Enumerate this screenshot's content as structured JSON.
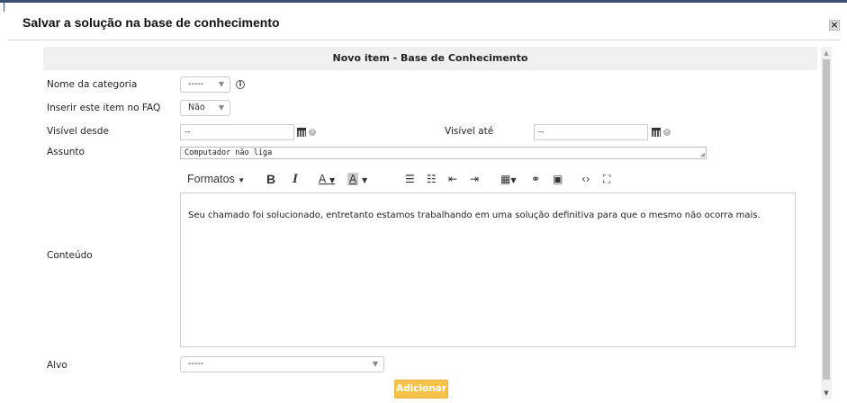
{
  "dialog": {
    "title": "Salvar a solução na base de conhecimento",
    "close_label": "×"
  },
  "form": {
    "section_title": "Novo item - Base de Conhecimento",
    "categoria": {
      "label": "Nome da categoria",
      "value": "-----"
    },
    "faq": {
      "label": "Inserir este item no FAQ",
      "value": "Não"
    },
    "visivel_desde": {
      "label": "Visível desde",
      "value": "--"
    },
    "visivel_ate": {
      "label": "Visível até",
      "value": "--"
    },
    "assunto": {
      "label": "Assunto",
      "value": "Computador não liga"
    },
    "conteudo": {
      "label": "Conteúdo",
      "text": "Seu chamado foi solucionado, entretanto estamos trabalhando em uma solução definitiva para que o mesmo não ocorra mais."
    },
    "alvo": {
      "label": "Alvo",
      "value": "-----"
    },
    "submit_label": "Adicionar"
  },
  "toolbar": {
    "formats_label": "Formatos",
    "bold_label": "B",
    "italic_label": "I",
    "text_color_label": "A",
    "bg_color_label": "A",
    "icons": [
      "caret-down-icon",
      "bullet-list-icon",
      "numbered-list-icon",
      "outdent-icon",
      "indent-icon",
      "table-icon",
      "link-icon",
      "image-icon",
      "code-icon",
      "fullscreen-icon"
    ]
  },
  "colors": {
    "header_line": "#3b4f73",
    "section_bg": "#f0f0f0",
    "button_accent": "#f7c24a"
  }
}
